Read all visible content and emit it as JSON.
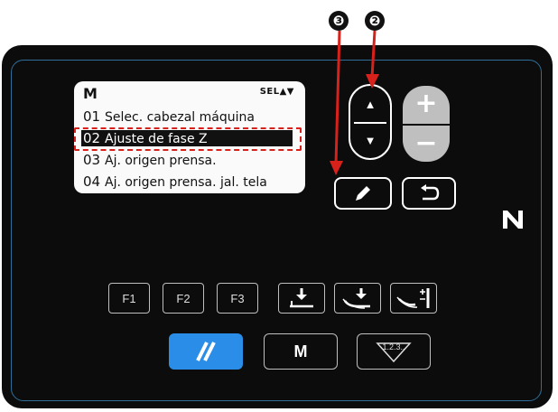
{
  "callouts": {
    "three": "❸",
    "two": "❷"
  },
  "lcd": {
    "mode": "M",
    "sel_indicator": "SEL▲▼",
    "rows": [
      {
        "num": "01",
        "label": "Selec. cabezal máquina"
      },
      {
        "num": "02",
        "label": "Ajuste de fase Z"
      },
      {
        "num": "03",
        "label": "Aj. origen prensa."
      },
      {
        "num": "04",
        "label": "Aj. origen prensa. jal. tela"
      }
    ]
  },
  "keys": {
    "up": "▲",
    "down": "▼",
    "plus": "+",
    "minus": "−",
    "f1": "F1",
    "f2": "F2",
    "f3": "F3",
    "m": "M",
    "sequence": "1.2.3.."
  },
  "colors": {
    "accent": "#2a8ee8",
    "highlight_box": "#d9211c",
    "panel": "#0c0c0c",
    "arrow": "#d9211c"
  }
}
